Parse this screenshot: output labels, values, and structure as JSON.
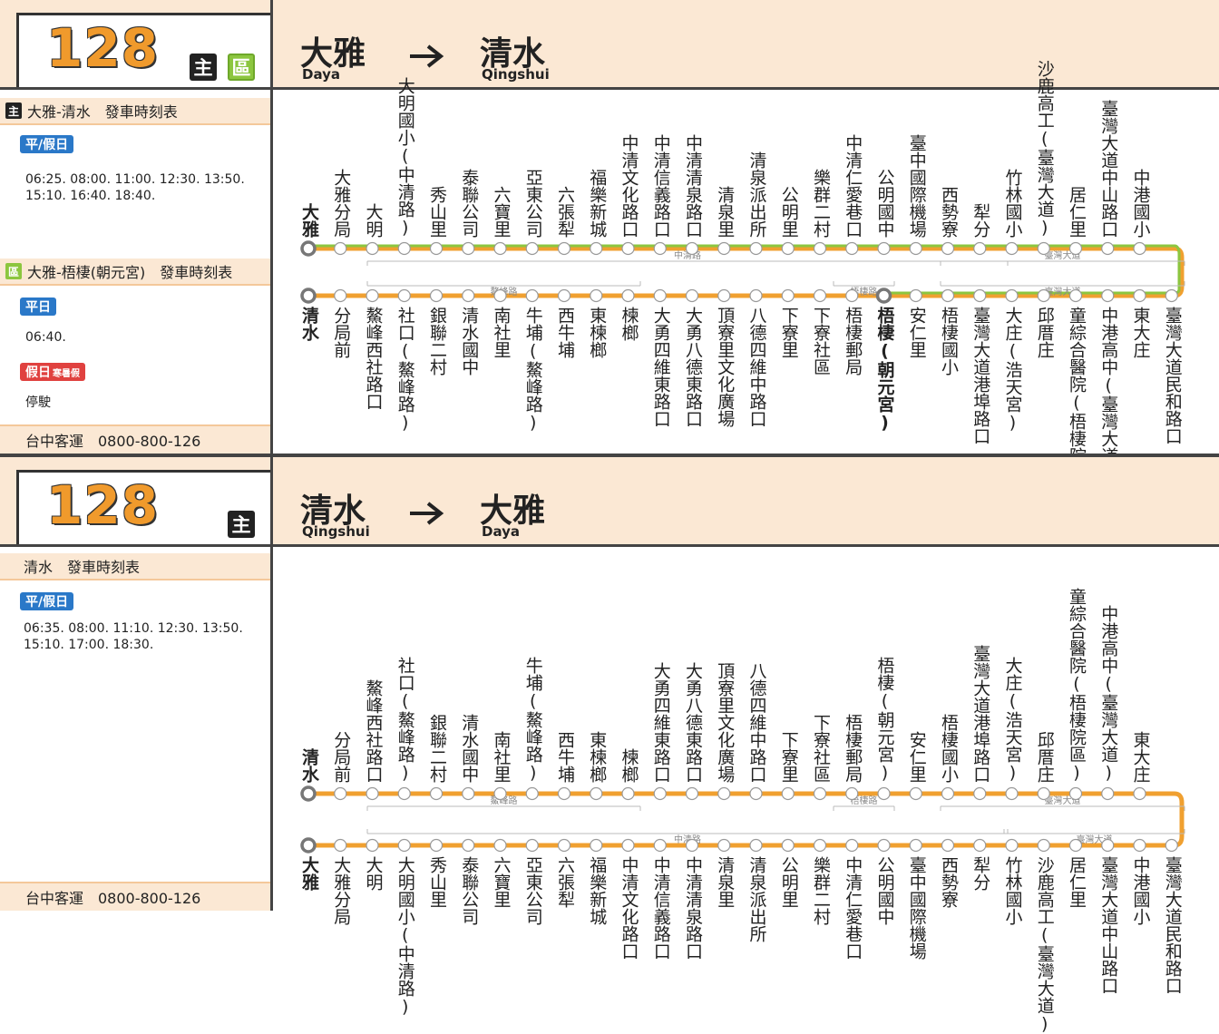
{
  "panel1": {
    "route_number": "128",
    "badges": [
      "主",
      "區"
    ],
    "from": {
      "zh": "大雅",
      "en": "Daya"
    },
    "to": {
      "zh": "清水",
      "en": "Qingshui"
    },
    "timetables": [
      {
        "badge": "主",
        "title": "大雅-清水　發車時刻表",
        "groups": [
          {
            "tag": "平/假日",
            "times": "06:25. 08:00. 11:00. 12:30. 13:50.\n15:10. 16:40. 18:40."
          }
        ]
      },
      {
        "badge": "區",
        "title": "大雅-梧棲(朝元宮)　發車時刻表",
        "groups": [
          {
            "tag": "平日",
            "times": "06:40."
          },
          {
            "tag": "假日",
            "tag_sub": "寒暑假",
            "times": "停駛"
          }
        ]
      }
    ],
    "footer": "台中客運　0800-800-126",
    "top_stops": [
      "大雅",
      "大雅分局",
      "大明",
      "大明國小(中清路)",
      "秀山里",
      "泰聯公司",
      "六寶里",
      "亞東公司",
      "六張犁",
      "福樂新城",
      "中清文化路口",
      "中清信義路口",
      "中清清泉路口",
      "清泉里",
      "清泉派出所",
      "公明里",
      "樂群二村",
      "中清仁愛巷口",
      "公明國中",
      "臺中國際機場",
      "西勢寮",
      "犁分",
      "竹林國小",
      "沙鹿高工(臺灣大道)",
      "居仁里",
      "臺灣大道中山路口",
      "中港國小"
    ],
    "bottom_stops": [
      "清水",
      "分局前",
      "鰲峰西社路口",
      "社口(鰲峰路)",
      "銀聯二村",
      "清水國中",
      "南社里",
      "牛埔(鰲峰路)",
      "西牛埔",
      "東楝榔",
      "楝榔",
      "大勇四維東路口",
      "大勇八德東路口",
      "頂寮里文化廣場",
      "八德四維中路口",
      "下寮里",
      "下寮社區",
      "梧棲郵局",
      "梧棲(朝元宮)",
      "安仁里",
      "梧棲國小",
      "臺灣大道港埠路口",
      "大庄(浩天宮)",
      "邱厝庄",
      "童綜合醫院(梧棲院區)",
      "中港高中(臺灣大道)",
      "東大庄",
      "臺灣大道民和路口"
    ],
    "road_labels": [
      "中清路",
      "臺灣大道",
      "鰲峰路",
      "梧棲路",
      "臺灣大道"
    ]
  },
  "panel2": {
    "route_number": "128",
    "badges": [
      "主"
    ],
    "from": {
      "zh": "清水",
      "en": "Qingshui"
    },
    "to": {
      "zh": "大雅",
      "en": "Daya"
    },
    "timetables": [
      {
        "badge": "",
        "title": "清水　發車時刻表",
        "groups": [
          {
            "tag": "平/假日",
            "times": "06:35. 08:00. 11:10. 12:30. 13:50.\n15:10. 17:00. 18:30."
          }
        ]
      }
    ],
    "footer": "台中客運　0800-800-126",
    "top_stops": [
      "清水",
      "分局前",
      "鰲峰西社路口",
      "社口(鰲峰路)",
      "銀聯二村",
      "清水國中",
      "南社里",
      "牛埔(鰲峰路)",
      "西牛埔",
      "東楝榔",
      "楝榔",
      "大勇四維東路口",
      "大勇八德東路口",
      "頂寮里文化廣場",
      "八德四維中路口",
      "下寮里",
      "下寮社區",
      "梧棲郵局",
      "梧棲(朝元宮)",
      "安仁里",
      "梧棲國小",
      "臺灣大道港埠路口",
      "大庄(浩天宮)",
      "邱厝庄",
      "童綜合醫院(梧棲院區)",
      "中港高中(臺灣大道)",
      "東大庄"
    ],
    "bottom_stops": [
      "大雅",
      "大雅分局",
      "大明",
      "大明國小(中清路)",
      "秀山里",
      "泰聯公司",
      "六寶里",
      "亞東公司",
      "六張犁",
      "福樂新城",
      "中清文化路口",
      "中清信義路口",
      "中清清泉路口",
      "清泉里",
      "清泉派出所",
      "公明里",
      "樂群二村",
      "中清仁愛巷口",
      "公明國中",
      "臺中國際機場",
      "西勢寮",
      "犁分",
      "竹林國小",
      "沙鹿高工(臺灣大道)",
      "居仁里",
      "臺灣大道中山路口",
      "中港國小",
      "臺灣大道民和路口"
    ],
    "road_labels": [
      "鰲峰路",
      "梧棲路",
      "臺灣大道",
      "中清路",
      "臺灣大道"
    ]
  },
  "colors": {
    "main_line": "#f0a030",
    "area_line": "#8cc63f",
    "header_bg": "#fbe8d4",
    "number": "#f09a2c"
  }
}
